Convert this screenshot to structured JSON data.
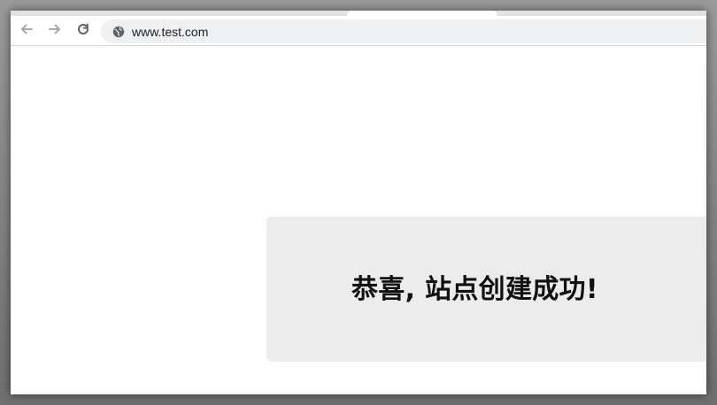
{
  "browser": {
    "url": "www.test.com",
    "icons": {
      "back": "arrow-left-icon",
      "forward": "arrow-right-icon",
      "reload": "reload-icon",
      "site_info": "globe-icon"
    },
    "colors": {
      "toolbar": "#ffffff",
      "omnibox": "#eff0f2",
      "icon_gray": "#5f6368",
      "disabled_gray": "#9aa0a6"
    }
  },
  "page": {
    "message": "恭喜, 站点创建成功!",
    "colors": {
      "background": "#ffffff",
      "card": "#ececed",
      "text": "#111111"
    }
  }
}
